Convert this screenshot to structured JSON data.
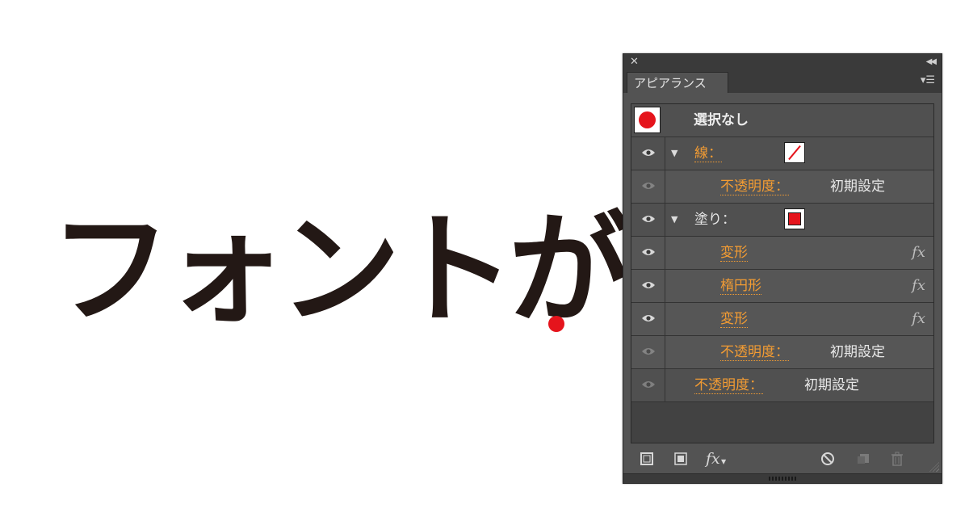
{
  "canvas": {
    "headline": "フォントが",
    "dot_color": "#e5141c"
  },
  "panel": {
    "close_icon": "close-icon",
    "collapse_icon": "double-chevron-left-icon",
    "tab_label": "アピアランス",
    "menu_icon": "panel-menu-icon",
    "header_label": "選択なし",
    "rows": [
      {
        "label": "線：",
        "type": "stroke",
        "swatch": "none"
      },
      {
        "label": "不透明度：",
        "value": "初期設定"
      },
      {
        "label": "塗り：",
        "type": "fill",
        "swatch": "red"
      },
      {
        "label": "変形",
        "fx": "fx"
      },
      {
        "label": "楕円形",
        "fx": "fx"
      },
      {
        "label": "変形",
        "fx": "fx"
      },
      {
        "label": "不透明度：",
        "value": "初期設定"
      },
      {
        "label": "不透明度：",
        "value": "初期設定"
      }
    ],
    "bottom": {
      "fx_label": "fx"
    }
  },
  "colors": {
    "accent_orange": "#f39c33",
    "swatch_red": "#e5141c",
    "panel_bg": "#535353"
  }
}
